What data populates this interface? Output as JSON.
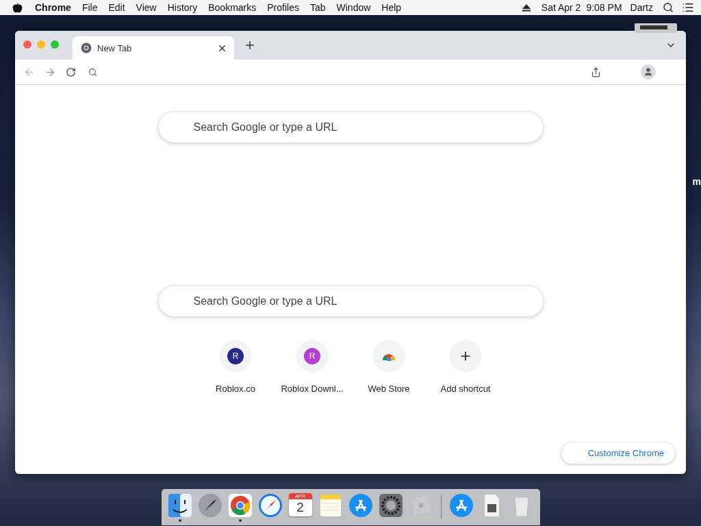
{
  "menu_bar": {
    "items": [
      {
        "label": "Chrome",
        "kind": "app"
      },
      {
        "label": "File",
        "kind": "menu"
      },
      {
        "label": "Edit",
        "kind": "menu"
      },
      {
        "label": "View",
        "kind": "menu"
      },
      {
        "label": "History",
        "kind": "menu"
      },
      {
        "label": "Bookmarks",
        "kind": "menu"
      },
      {
        "label": "Profiles",
        "kind": "menu"
      },
      {
        "label": "Tab",
        "kind": "menu"
      },
      {
        "label": "Window",
        "kind": "menu"
      },
      {
        "label": "Help",
        "kind": "menu"
      }
    ],
    "date": "Sat Apr 2",
    "time": "9:08 PM",
    "user": "Dartz"
  },
  "desktop": {
    "cut_label": "m"
  },
  "browser": {
    "tabs": [
      {
        "title": "New Tab",
        "selected": true
      }
    ],
    "search_fields": [
      {
        "placeholder": "Search Google or type a URL"
      },
      {
        "placeholder": "Search Google or type a URL"
      }
    ],
    "shortcuts": [
      {
        "kind": "letter",
        "initial": "R",
        "color": "#252a8a",
        "label": "Roblox.co"
      },
      {
        "kind": "letter",
        "initial": "R",
        "color": "#b53fd1",
        "label": "Roblox Downl..."
      },
      {
        "kind": "webstore",
        "label": "Web Store"
      },
      {
        "kind": "add",
        "label": "Add shortcut"
      }
    ],
    "customize_button": "Customize Chrome"
  },
  "dock": [
    {
      "kind": "finder",
      "running": true
    },
    {
      "kind": "launchpad",
      "running": false
    },
    {
      "kind": "chrome",
      "running": true
    },
    {
      "kind": "safari",
      "running": false
    },
    {
      "kind": "calendar",
      "month": "APR",
      "day": "2",
      "running": false
    },
    {
      "kind": "notes",
      "running": false
    },
    {
      "kind": "appstore",
      "running": false
    },
    {
      "kind": "settings",
      "running": false
    },
    {
      "kind": "roblox",
      "running": false
    },
    {
      "kind": "separator"
    },
    {
      "kind": "appstore-folder",
      "running": false
    },
    {
      "kind": "document",
      "running": false
    },
    {
      "kind": "trash",
      "running": false
    }
  ]
}
